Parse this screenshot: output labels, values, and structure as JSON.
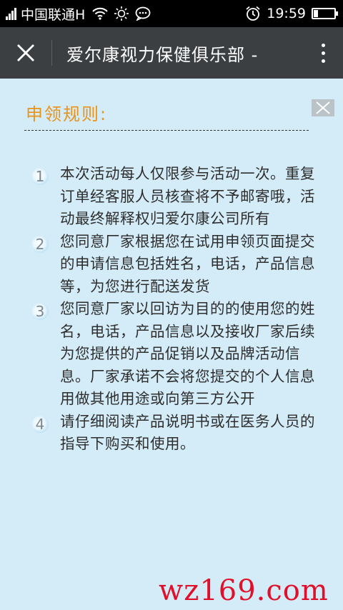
{
  "status_bar": {
    "carrier": "中国联通H",
    "time": "19:59",
    "icons": [
      "signal-icon",
      "wifi-icon",
      "brightness-icon",
      "chat-icon",
      "alarm-icon",
      "battery-icon"
    ]
  },
  "app_bar": {
    "title": "爱尔康视力保健俱乐部 -",
    "close_icon": "close-icon",
    "more_icon": "more-vertical-icon"
  },
  "panel": {
    "title": "申领规则:",
    "close_icon": "close-icon"
  },
  "rules": [
    {
      "num": "1",
      "text": "本次活动每人仅限参与活动一次。重复订单经客服人员核查将不予邮寄哦，活动最终解释权归爱尔康公司所有"
    },
    {
      "num": "2",
      "text": "您同意厂家根据您在试用申领页面提交的申请信息包括姓名，电话，产品信息等，为您进行配送发货"
    },
    {
      "num": "3",
      "text": "您同意厂家以回访为目的的使用您的姓名，电话，产品信息以及接收厂家后续为您提供的产品促销以及品牌活动信息。厂家承诺不会将您提交的个人信息用做其他用途或向第三方公开"
    },
    {
      "num": "4",
      "text": "请仔细阅读产品说明书或在医务人员的指导下购买和使用。"
    }
  ],
  "watermark": "wz169.com",
  "colors": {
    "status_bar_bg": "#000000",
    "app_bar_bg": "#3b3f42",
    "content_bg": "#d4ecf8",
    "panel_title": "#e8931a",
    "watermark": "#e1102a"
  }
}
